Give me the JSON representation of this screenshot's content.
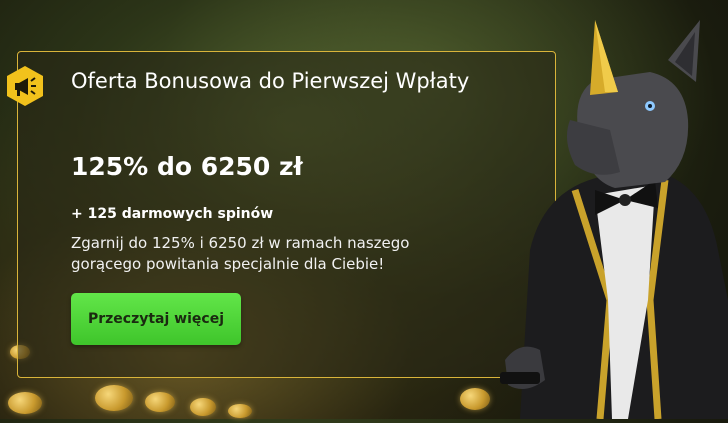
{
  "promo": {
    "title": "Oferta Bonusowa do Pierwszej Wpłaty",
    "amount": "125% do 6250 zł",
    "spins": "+ 125 darmowych spinów",
    "description": "Zgarnij do 125% i 6250 zł w ramach naszego gorącego powitania specjalnie dla Ciebie!",
    "cta_label": "Przeczytaj więcej"
  },
  "icons": {
    "badge": "megaphone-icon",
    "mascot": "rhino-in-tuxedo-illustration"
  },
  "colors": {
    "accent_gold": "#d9b43a",
    "cta_green": "#4cd438",
    "text_white": "#ffffff"
  }
}
